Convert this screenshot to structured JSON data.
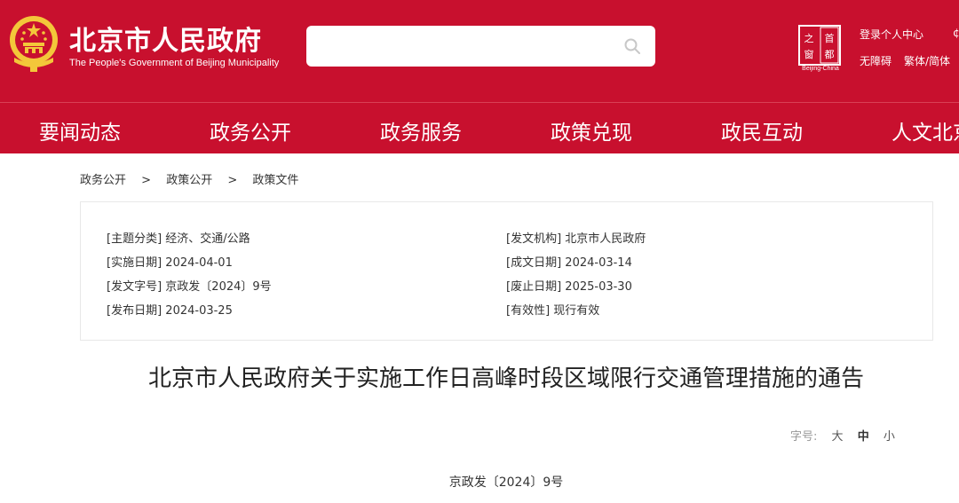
{
  "header": {
    "title": "北京市人民政府",
    "subtitle": "The People's Government of Beijing Municipality",
    "search": {
      "placeholder": "",
      "value": ""
    },
    "capital_logo": {
      "top_chars": "首都",
      "side_chars": "之窗",
      "caption": "Beijing-China"
    },
    "links": {
      "login": "登录个人中心",
      "accessible": "无障碍",
      "traditional": "繁体/简体",
      "edge_char": "¢"
    },
    "colors": {
      "brand_red": "#c8102e",
      "emblem_gold": "#f3c73a"
    }
  },
  "nav": {
    "items": [
      "要闻动态",
      "政务公开",
      "政务服务",
      "政策兑现",
      "政民互动",
      "人文北京"
    ]
  },
  "breadcrumb": [
    "政务公开",
    "政策公开",
    "政策文件"
  ],
  "breadcrumb_sep": ">",
  "info": {
    "left": [
      {
        "label": "[主题分类]",
        "value": "经济、交通/公路"
      },
      {
        "label": "[实施日期]",
        "value": "2024-04-01"
      },
      {
        "label": "[发文字号]",
        "value": "京政发〔2024〕9号"
      },
      {
        "label": "[发布日期]",
        "value": "2024-03-25"
      }
    ],
    "right": [
      {
        "label": "[发文机构]",
        "value": "北京市人民政府"
      },
      {
        "label": "[成文日期]",
        "value": "2024-03-14"
      },
      {
        "label": "[废止日期]",
        "value": "2025-03-30"
      },
      {
        "label": "[有效性]",
        "value": "现行有效"
      }
    ]
  },
  "document": {
    "title": "北京市人民政府关于实施工作日高峰时段区域限行交通管理措施的通告",
    "number": "京政发〔2024〕9号"
  },
  "font_size": {
    "label": "字号:",
    "options": [
      "大",
      "中",
      "小"
    ],
    "selected": "中"
  }
}
